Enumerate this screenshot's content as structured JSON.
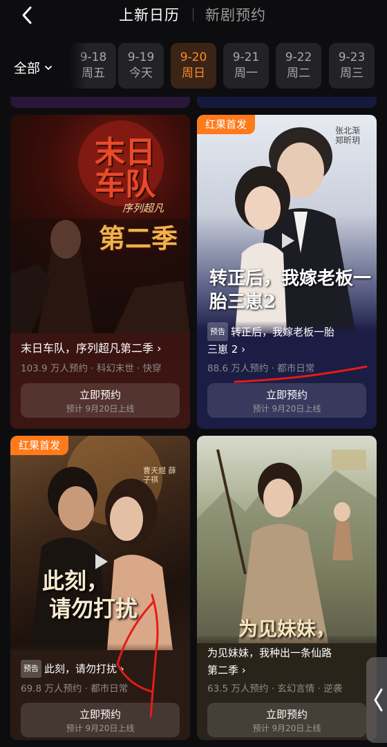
{
  "header": {
    "tab_active": "上新日历",
    "tab_inactive": "新剧预约"
  },
  "filter": {
    "label": "全部"
  },
  "dates": [
    {
      "date": "9-18",
      "day": "周五"
    },
    {
      "date": "9-19",
      "day": "今天"
    },
    {
      "date": "9-20",
      "day": "周日",
      "selected": true
    },
    {
      "date": "9-21",
      "day": "周一"
    },
    {
      "date": "9-22",
      "day": "周二"
    },
    {
      "date": "9-23",
      "day": "周三"
    }
  ],
  "cards": [
    {
      "poster_title_1": "末日",
      "poster_title_2": "车队",
      "poster_subtitle": "序列超凡",
      "poster_season": "第二季",
      "title": "末日车队，序列超凡第二季 ›",
      "meta": "103.9 万人预约 · 科幻末世 · 快穿",
      "btn_label": "立即预约",
      "btn_sub": "预计 9月20日上线"
    },
    {
      "badge": "红果首发",
      "poster_title": "转正后，我嫁老板一胎三崽2",
      "poster_names": "张北渐 郑昕玥",
      "pre_tag": "预告",
      "title_line1": "转正后，我嫁老板一胎",
      "title_line2": "三崽 2 ›",
      "meta": "88.6 万人预约 · 都市日常",
      "btn_label": "立即预约",
      "btn_sub": "预计 9月20日上线"
    },
    {
      "badge": "红果首发",
      "poster_title_1": "此刻，",
      "poster_title_2": "请勿打扰",
      "poster_names": "曹天煜 薛子祺",
      "pre_tag": "预告",
      "title": "此刻，请勿打扰 ›",
      "meta": "69.8 万人预约 · 都市日常",
      "btn_label": "立即预约",
      "btn_sub": "预计 9月20日上线"
    },
    {
      "poster_title": "为见妹妹，",
      "title_line1": "为见妹妹，我种出一条仙路",
      "title_line2": "第二季 ›",
      "meta": "63.5 万人预约 · 玄幻言情 · 逆袭",
      "btn_label": "立即预约",
      "btn_sub": "预计 9月20日上线"
    }
  ],
  "colors": {
    "accent": "#ff8a2b",
    "badge": "#ff7a1a",
    "card1_info_bg": "#3c1612",
    "card2_info_bg": "#1b1d45",
    "card3_info_bg": "#2a1a14",
    "card4_info_bg": "#2a231a"
  },
  "icons": {
    "back": "chevron-left-icon",
    "filter": "chevron-down-icon",
    "play": "play-icon",
    "side": "chevron-left-icon"
  }
}
